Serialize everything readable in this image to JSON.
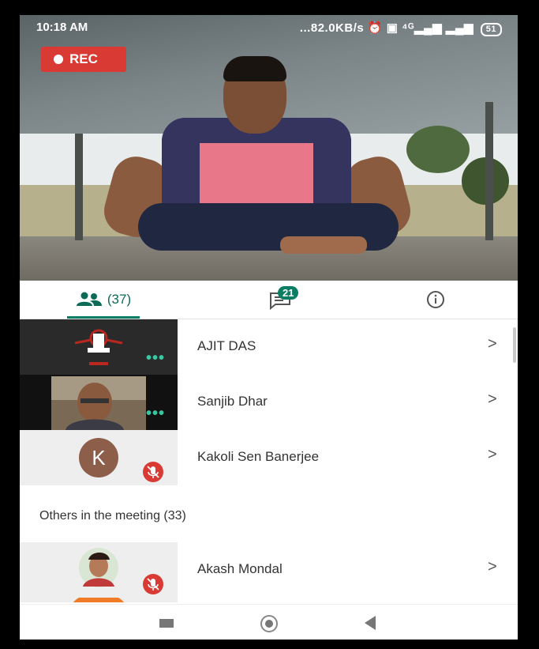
{
  "status_bar": {
    "time": "10:18 AM",
    "right": "...82.0KB/s ⏰ ▣ ⁴ᴳ▂▄▆ ▂▄▆",
    "battery": "51"
  },
  "recording": {
    "label": "REC"
  },
  "tabs": {
    "people_count": "(37)",
    "chat_badge": "21"
  },
  "participants": [
    {
      "name": "AJIT DAS",
      "chevron": ">",
      "more_icon": "more-dots-icon"
    },
    {
      "name": "Sanjib Dhar",
      "chevron": ">",
      "more_icon": "more-dots-icon"
    },
    {
      "name": "Kakoli Sen Banerjee",
      "chevron": ">",
      "avatar_letter": "K",
      "mic": "mic-off-icon"
    }
  ],
  "others_section": {
    "title": "Others in the meeting (33)",
    "items": [
      {
        "name": "Akash Mondal",
        "chevron": ">",
        "mic": "mic-off-icon"
      }
    ]
  },
  "colors": {
    "accent": "#0b7d63",
    "rec": "#d93a33",
    "avatar_k": "#8d5f4b"
  }
}
